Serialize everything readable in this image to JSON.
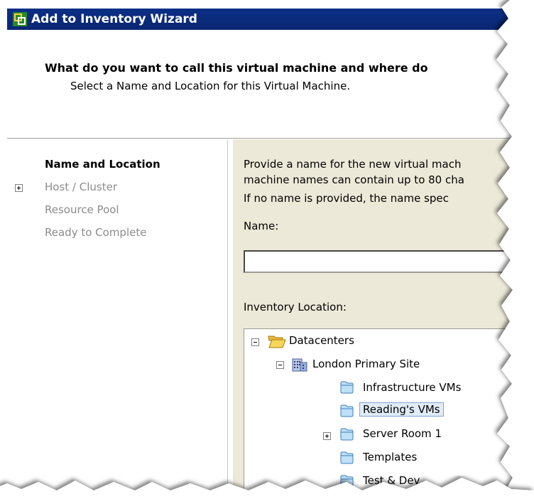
{
  "window": {
    "title": "Add to Inventory Wizard"
  },
  "header": {
    "question": "What do you want to call this virtual machine and where do",
    "subtitle": "Select a Name and Location for this Virtual Machine."
  },
  "steps": [
    {
      "label": "Name and Location",
      "active": true,
      "has_expander": false
    },
    {
      "label": "Host / Cluster",
      "active": false,
      "has_expander": true
    },
    {
      "label": "Resource Pool",
      "active": false,
      "has_expander": false
    },
    {
      "label": "Ready to Complete",
      "active": false,
      "has_expander": false
    }
  ],
  "content": {
    "description_line1": "Provide a name for the new virtual mach",
    "description_line2": "machine names can contain up to 80 cha",
    "description_line3": "If no name is provided, the name spec",
    "name_label": "Name:",
    "name_value": "",
    "inventory_label": "Inventory Location:"
  },
  "tree": {
    "root": "Datacenters",
    "site": "London Primary Site",
    "folders": [
      {
        "label": "Infrastructure VMs",
        "selected": false,
        "expandable": false
      },
      {
        "label": "Reading's VMs",
        "selected": true,
        "expandable": false
      },
      {
        "label": "Server Room 1",
        "selected": false,
        "expandable": true
      },
      {
        "label": "Templates",
        "selected": false,
        "expandable": false
      },
      {
        "label": "Test & Dev",
        "selected": false,
        "expandable": false
      }
    ]
  },
  "colors": {
    "titlebar": "#0b2f86",
    "panel_bg": "#ece9d8",
    "selection_bg": "#e1ecf7",
    "selection_border": "#7fa5d6"
  }
}
